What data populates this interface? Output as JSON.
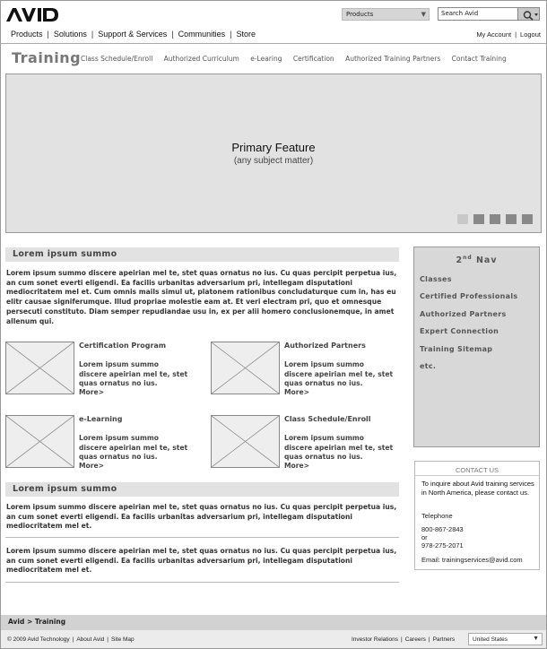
{
  "header": {
    "products_select": "Products",
    "search_value": "Search Avid",
    "topnav": [
      "Products",
      "Solutions",
      "Support & Services",
      "Communities",
      "Store"
    ],
    "util": [
      "My Account",
      "Logout"
    ]
  },
  "section": {
    "title": "Training",
    "subnav": [
      "Class Schedule/Enroll",
      "Authorized Curriculum",
      "e-Learing",
      "Certification",
      "Authorized Training Partners",
      "Contact Training"
    ]
  },
  "hero": {
    "title": "Primary Feature",
    "subtitle": "(any subject matter)",
    "slide_count": 5,
    "active_slide": 1
  },
  "main": {
    "heading1": "Lorem ipsum summo",
    "para1": "Lorem ipsum summo discere apeirian mel te, stet quas ornatus no ius. Cu quas percipit perpetua ius, an cum sonet everti eligendi. Ea facilis urbanitas adversarium pri, intellegam disputationi mediocritatem mel et. Cum omnis mails simul ut, platonem rationibus concludaturque cum in, has eu elitr causae signiferumque. Illud propriae molestie eam at. Et veri electram pri, quo et omnesque persecuti constituto. Diam semper repudiandae usu in, ex per alii homero conclusionemque, in amet allenum qui.",
    "cards": [
      {
        "title": "Certification Program",
        "text": "Lorem ipsum summo discere apeirian mel te, stet quas ornatus no ius.",
        "more": "More>"
      },
      {
        "title": "Authorized Partners",
        "text": "Lorem ipsum summo discere apeirian mel te, stet quas ornatus no ius.",
        "more": "More>"
      },
      {
        "title": "e-Learning",
        "text": "Lorem ipsum summo discere apeirian mel te, stet quas ornatus no ius.",
        "more": "More>"
      },
      {
        "title": "Class Schedule/Enroll",
        "text": "Lorem ipsum summo discere apeirian mel te, stet quas ornatus no ius.",
        "more": "More>"
      }
    ],
    "heading2": "Lorem ipsum summo",
    "para2": "Lorem ipsum summo discere apeirian mel te, stet quas ornatus no ius. Cu quas percipit perpetua ius, an cum sonet everti eligendi. Ea facilis urbanitas adversarium pri, intellegam disputationi mediocritatem mel et.",
    "para3": "Lorem ipsum summo discere apeirian mel te, stet quas ornatus no ius. Cu quas percipit perpetua ius, an cum sonet everti eligendi. Ea facilis urbanitas adversarium pri, intellegam disputationi mediocritatem mel et."
  },
  "sidenav": {
    "head_pre": "2",
    "head_sup": "nd",
    "head_post": " Nav",
    "items": [
      "Classes",
      "Certified Professionals",
      "Authorized Partners",
      "Expert Connection",
      "Training Sitemap",
      "etc."
    ]
  },
  "contact": {
    "heading": "CONTACT US",
    "intro": "To inquire about Avid training services in North America, please contact us.",
    "tel_label": "Telephone",
    "phone1": "800-867-2843",
    "or": "or",
    "phone2": "978-275-2071",
    "email": "Email: trainingservices@avid.com"
  },
  "footer": {
    "breadcrumb": "Avid > Training",
    "copyright": "© 2009 Avid Technology",
    "about": "About Avid",
    "sitemap": "Site Map",
    "links": [
      "Investor Relations",
      "Careers",
      "Partners"
    ],
    "country": "United States"
  },
  "colors": {
    "panel": "#e2e2e2",
    "sidenav": "#d8d8d8",
    "slide_inactive": "#888888",
    "slide_active": "#c8c8c8"
  },
  "icons": [
    "avid-logo",
    "search-icon",
    "chevron-down-icon",
    "image-placeholder"
  ]
}
